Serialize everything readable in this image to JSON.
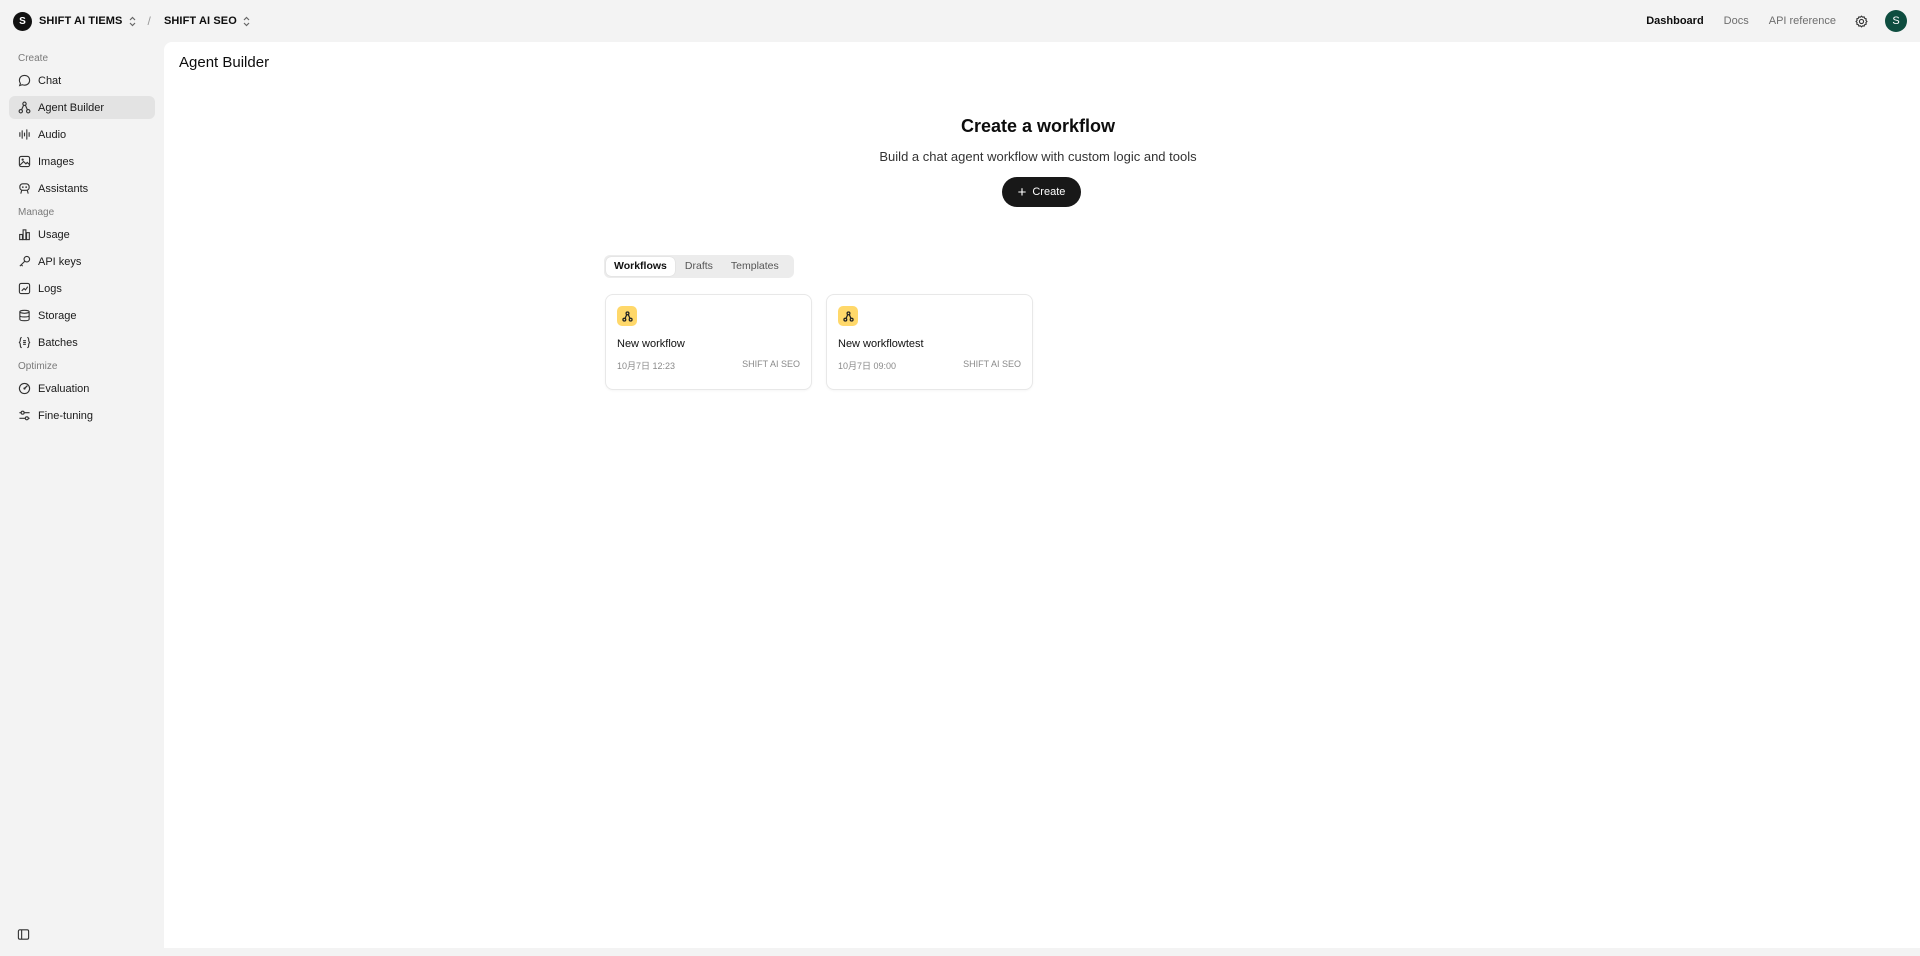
{
  "topbar": {
    "org_initial": "S",
    "org_name": "SHIFT AI TIEMS",
    "separator": "/",
    "project_name": "SHIFT AI SEO",
    "links": [
      "Dashboard",
      "Docs",
      "API reference"
    ],
    "user_initial": "S"
  },
  "sidebar": {
    "sections": [
      {
        "label": "Create",
        "items": [
          "Chat",
          "Agent Builder",
          "Audio",
          "Images",
          "Assistants"
        ]
      },
      {
        "label": "Manage",
        "items": [
          "Usage",
          "API keys",
          "Logs",
          "Storage",
          "Batches"
        ]
      },
      {
        "label": "Optimize",
        "items": [
          "Evaluation",
          "Fine-tuning"
        ]
      }
    ],
    "active_item": "Agent Builder"
  },
  "main": {
    "page_title": "Agent Builder",
    "hero_title": "Create a workflow",
    "hero_subtitle": "Build a chat agent workflow with custom logic and tools",
    "create_label": "Create",
    "tabs": [
      "Workflows",
      "Drafts",
      "Templates"
    ],
    "active_tab": "Workflows",
    "cards": [
      {
        "title": "New workflow",
        "date": "10月7日 12:23",
        "project": "SHIFT AI SEO"
      },
      {
        "title": "New workflowtest",
        "date": "10月7日 09:00",
        "project": "SHIFT AI SEO"
      }
    ]
  },
  "colors": {
    "accent_dark": "#181818",
    "card_icon_bg": "#ffd86a",
    "user_avatar_bg": "#0e4d3f"
  },
  "icons": {
    "chat": "chat-bubble-icon",
    "agent_builder": "workflow-nodes-icon",
    "audio": "audio-waveform-icon",
    "images": "image-icon",
    "assistants": "robot-icon",
    "usage": "bar-chart-icon",
    "api_keys": "key-icon",
    "logs": "logs-icon",
    "storage": "database-icon",
    "batches": "batches-icon",
    "evaluation": "gauge-icon",
    "fine_tuning": "sliders-icon"
  }
}
